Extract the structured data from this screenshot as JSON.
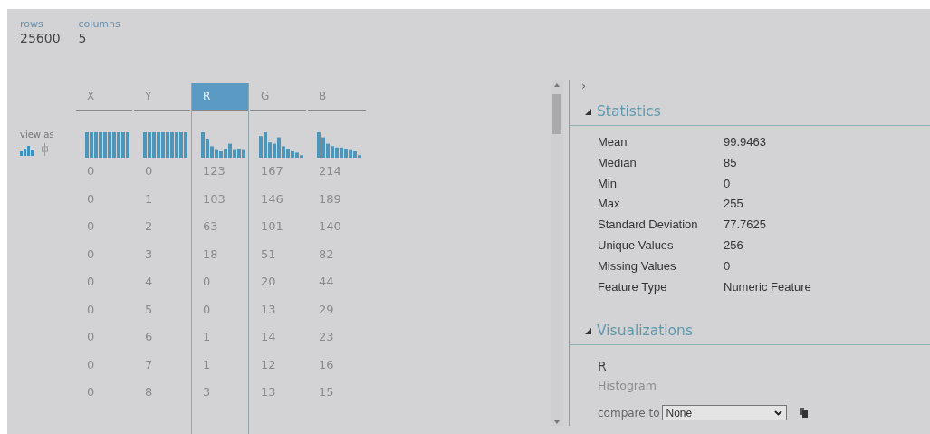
{
  "summary": [
    {
      "label": "rows",
      "value": "25600"
    },
    {
      "label": "columns",
      "value": "5"
    }
  ],
  "view_as": {
    "label": "view as",
    "options": [
      {
        "kind": "histogram",
        "selected": true
      },
      {
        "kind": "boxplot",
        "selected": false
      }
    ]
  },
  "table": {
    "columns": [
      {
        "name": "X",
        "selected": false
      },
      {
        "name": "Y",
        "selected": false
      },
      {
        "name": "R",
        "selected": true
      },
      {
        "name": "G",
        "selected": false
      },
      {
        "name": "B",
        "selected": false
      }
    ],
    "rows": [
      [
        "0",
        "0",
        "123",
        "167",
        "214"
      ],
      [
        "0",
        "1",
        "103",
        "146",
        "189"
      ],
      [
        "0",
        "2",
        "63",
        "101",
        "140"
      ],
      [
        "0",
        "3",
        "18",
        "51",
        "82"
      ],
      [
        "0",
        "4",
        "0",
        "20",
        "44"
      ],
      [
        "0",
        "5",
        "0",
        "13",
        "29"
      ],
      [
        "0",
        "6",
        "1",
        "14",
        "23"
      ],
      [
        "0",
        "7",
        "1",
        "12",
        "16"
      ],
      [
        "0",
        "8",
        "3",
        "13",
        "15"
      ]
    ]
  },
  "panel": {
    "toggle": "›",
    "statistics": {
      "title": "Statistics",
      "expanded": true,
      "rows": [
        {
          "label": "Mean",
          "value": "99.9463"
        },
        {
          "label": "Median",
          "value": "85"
        },
        {
          "label": "Min",
          "value": "0"
        },
        {
          "label": "Max",
          "value": "255"
        },
        {
          "label": "Standard Deviation",
          "value": "77.7625"
        },
        {
          "label": "Unique Values",
          "value": "256"
        },
        {
          "label": "Missing Values",
          "value": "0"
        },
        {
          "label": "Feature Type",
          "value": "Numeric Feature"
        }
      ]
    },
    "visualizations": {
      "title": "Visualizations",
      "expanded": true,
      "column": "R",
      "chart_kind": "Histogram",
      "compare_label": "compare to",
      "compare_value": "None"
    }
  }
}
